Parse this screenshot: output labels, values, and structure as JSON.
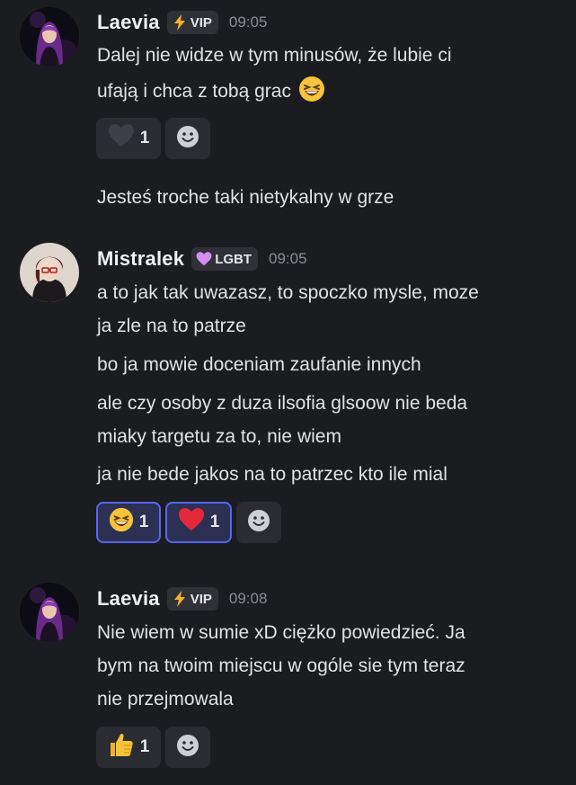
{
  "messages": [
    {
      "author": "Laevia",
      "badge": "VIP",
      "time": "09:05",
      "lines": [
        "Dalej nie widze w tym minusów, że lubie ci",
        "ufają i chca z tobą grac"
      ],
      "reactions": [
        {
          "emoji": "black-heart",
          "count": "1"
        }
      ],
      "followup": "Jesteś troche taki nietykalny w grze"
    },
    {
      "author": "Mistralek",
      "badge": "LGBT",
      "time": "09:05",
      "lines": [
        "a to jak tak uwazasz, to spoczko mysle, moze",
        "ja zle na to patrze",
        "bo ja mowie doceniam zaufanie innych",
        "ale czy osoby z duza ilsofia glsoow nie beda",
        "miaky targetu za to, nie wiem",
        "ja nie bede jakos na to patrzec kto ile mial"
      ],
      "reactions": [
        {
          "emoji": "laughing-face",
          "count": "1"
        },
        {
          "emoji": "red-heart",
          "count": "1"
        }
      ]
    },
    {
      "author": "Laevia",
      "badge": "VIP",
      "time": "09:08",
      "lines": [
        "Nie wiem w sumie xD ciężko powiedzieć. Ja",
        "bym na twoim miejscu w ogóle sie tym teraz",
        "nie przejmowala"
      ],
      "reactions": [
        {
          "emoji": "thumbs-up",
          "count": "1"
        }
      ]
    }
  ],
  "colors": {
    "background": "#1b1c20",
    "reaction_bg": "#2a2c31",
    "reaction_active_border": "#5865f2",
    "badge_bg": "#2f3137"
  }
}
